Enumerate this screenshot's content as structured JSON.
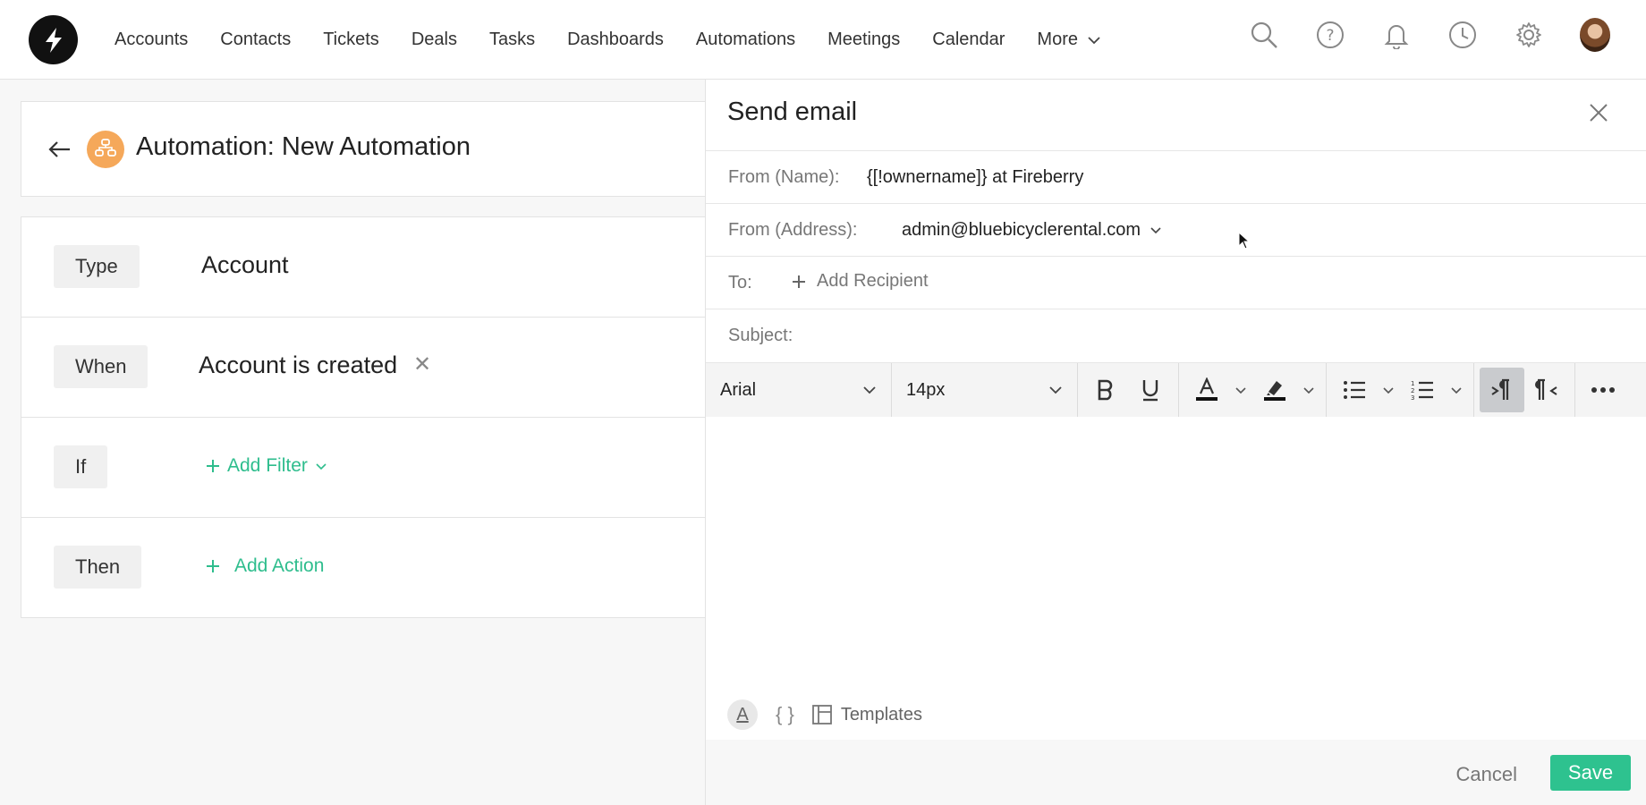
{
  "nav": {
    "items": [
      "Accounts",
      "Contacts",
      "Tickets",
      "Deals",
      "Tasks",
      "Dashboards",
      "Automations",
      "Meetings",
      "Calendar"
    ],
    "more_label": "More"
  },
  "header": {
    "title": "Automation: New Automation"
  },
  "rules": {
    "type_tag": "Type",
    "type_value": "Account",
    "when_tag": "When",
    "when_value": "Account is created",
    "if_tag": "If",
    "add_filter": "Add Filter",
    "then_tag": "Then",
    "add_action": "Add Action"
  },
  "drawer": {
    "title": "Send email",
    "from_name_label": "From (Name):",
    "from_name_value": "{[!ownername]} at Fireberry",
    "from_address_label": "From (Address):",
    "from_address_value": "admin@bluebicyclerental.com",
    "to_label": "To:",
    "add_recipient": "Add Recipient",
    "subject_label": "Subject:",
    "font_family": "Arial",
    "font_size": "14px",
    "templates_label": "Templates",
    "cancel_label": "Cancel",
    "save_label": "Save"
  },
  "colors": {
    "accent": "#2ec28f",
    "automation_icon": "#f5a85a"
  }
}
